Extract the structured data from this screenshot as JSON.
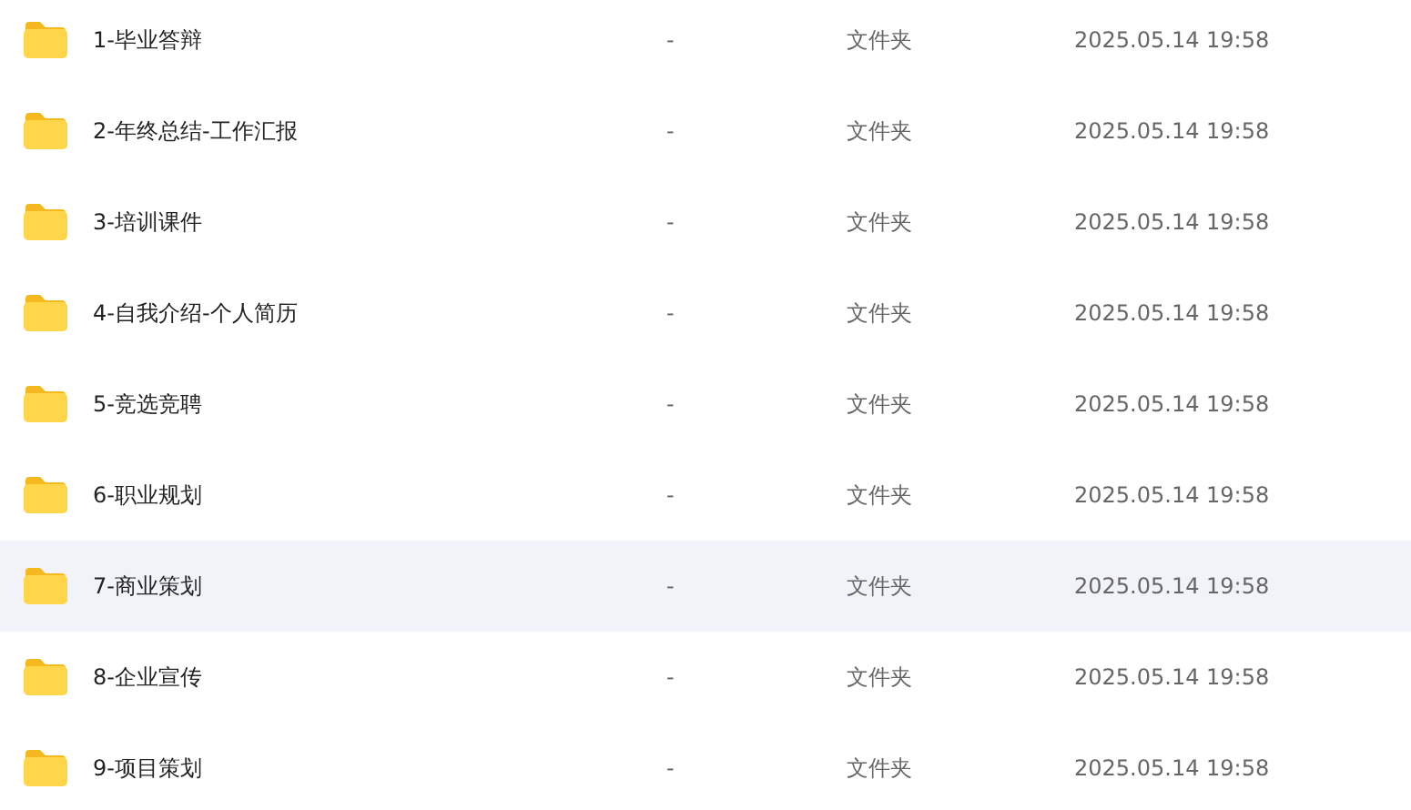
{
  "files": [
    {
      "name": "1-毕业答辩",
      "size": "-",
      "type": "文件夹",
      "modified": "2025.05.14 19:58",
      "highlighted": false
    },
    {
      "name": "2-年终总结-工作汇报",
      "size": "-",
      "type": "文件夹",
      "modified": "2025.05.14 19:58",
      "highlighted": false
    },
    {
      "name": "3-培训课件",
      "size": "-",
      "type": "文件夹",
      "modified": "2025.05.14 19:58",
      "highlighted": false
    },
    {
      "name": "4-自我介绍-个人简历",
      "size": "-",
      "type": "文件夹",
      "modified": "2025.05.14 19:58",
      "highlighted": false
    },
    {
      "name": "5-竞选竞聘",
      "size": "-",
      "type": "文件夹",
      "modified": "2025.05.14 19:58",
      "highlighted": false
    },
    {
      "name": "6-职业规划",
      "size": "-",
      "type": "文件夹",
      "modified": "2025.05.14 19:58",
      "highlighted": false
    },
    {
      "name": "7-商业策划",
      "size": "-",
      "type": "文件夹",
      "modified": "2025.05.14 19:58",
      "highlighted": true
    },
    {
      "name": "8-企业宣传",
      "size": "-",
      "type": "文件夹",
      "modified": "2025.05.14 19:58",
      "highlighted": false
    },
    {
      "name": "9-项目策划",
      "size": "-",
      "type": "文件夹",
      "modified": "2025.05.14 19:58",
      "highlighted": false
    }
  ]
}
